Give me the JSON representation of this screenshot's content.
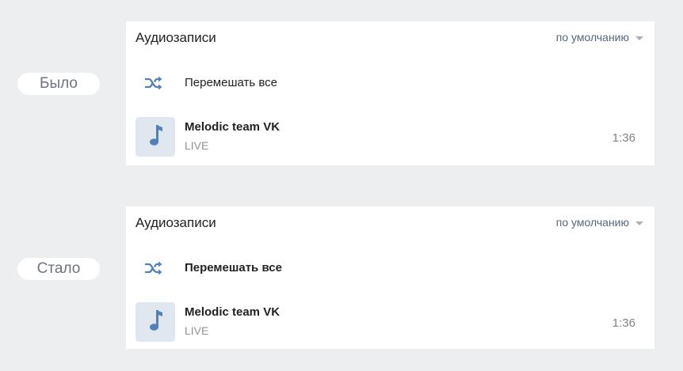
{
  "before": {
    "pill_label": "Было",
    "card": {
      "title": "Аудиозаписи",
      "sort_label": "по умолчанию",
      "shuffle_icon": "shuffle-icon",
      "shuffle_label": "Перемешать все",
      "track": {
        "cover_icon": "music-note-icon",
        "title": "Melodic team VK",
        "artist": "LIVE",
        "duration": "1:36"
      }
    }
  },
  "after": {
    "pill_label": "Стало",
    "card": {
      "title": "Аудиозаписи",
      "sort_label": "по умолчанию",
      "shuffle_icon": "shuffle-icon",
      "shuffle_label": "Перемешать все",
      "track": {
        "cover_icon": "music-note-icon",
        "title": "Melodic team VK",
        "artist": "LIVE",
        "duration": "1:36"
      }
    }
  },
  "colors": {
    "background": "#edeef0",
    "accent_blue": "#55677d",
    "cover_bg": "#e1e7ef",
    "icon_blue": "#5181b8"
  }
}
